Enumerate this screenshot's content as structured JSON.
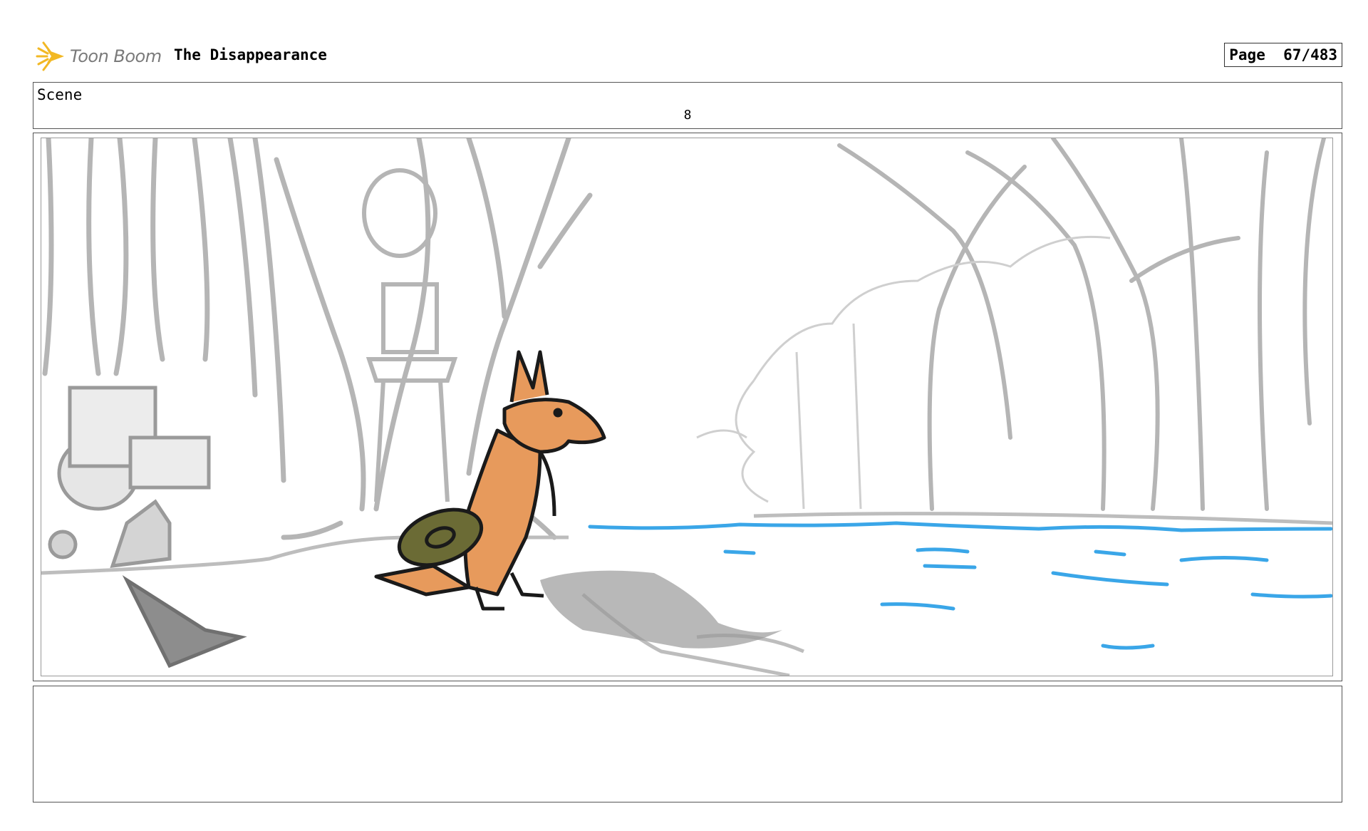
{
  "header": {
    "logo_text": "Toon Boom",
    "title": "The Disappearance",
    "page_label": "Page",
    "page_number": "67/483"
  },
  "scene": {
    "label": "Scene",
    "number": "8"
  },
  "panel": {
    "water_color": "#3aa6e8",
    "fox_color": "#e79a5c",
    "hat_color": "#6b6b35",
    "sketch_color": "#b5b5b5"
  },
  "notes": {
    "text": ""
  }
}
